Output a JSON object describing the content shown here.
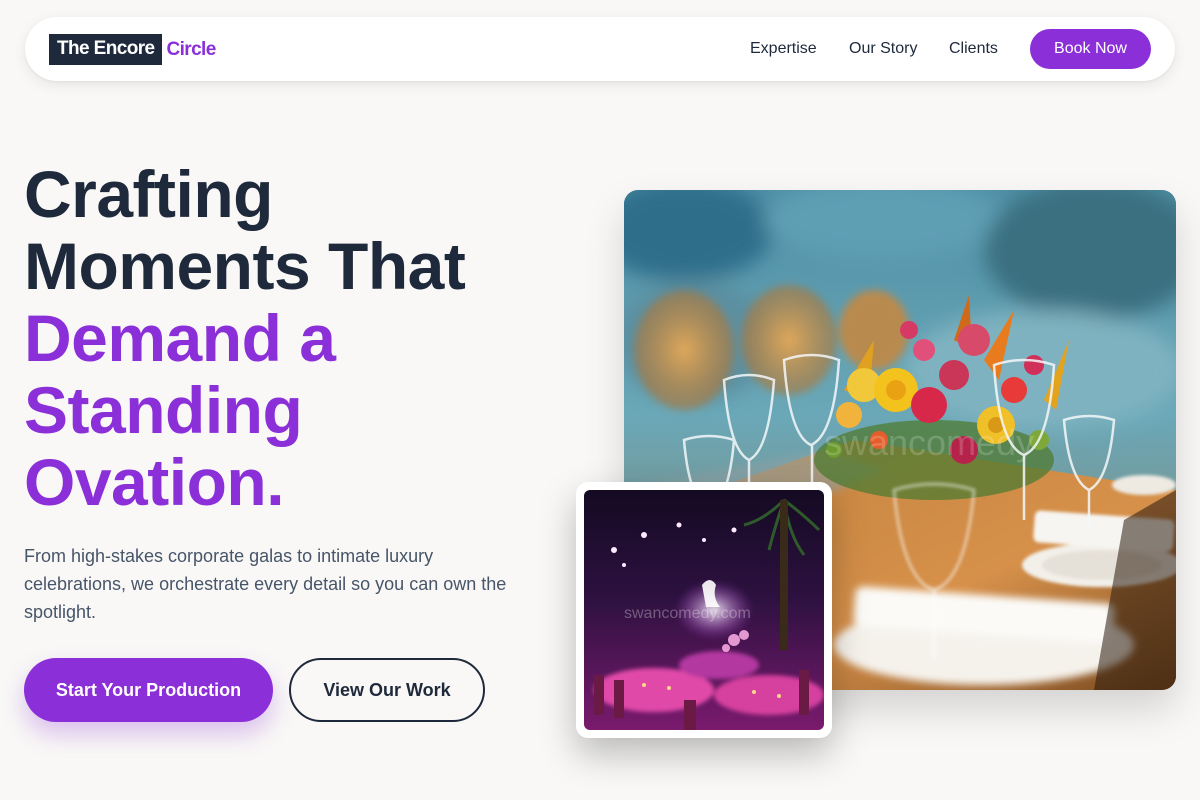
{
  "brand": {
    "name_dark": "The Encore",
    "name_accent": "Circle"
  },
  "nav": {
    "links": [
      "Expertise",
      "Our Story",
      "Clients"
    ],
    "cta_label": "Book Now"
  },
  "hero": {
    "title_lines_dark": [
      "Crafting",
      "Moments That"
    ],
    "title_lines_accent": [
      "Demand a",
      "Standing",
      "Ovation."
    ],
    "subtitle": "From high-stakes corporate galas to intimate luxury celebrations, we orchestrate every detail so you can own the spotlight.",
    "primary_button": "Start Your Production",
    "secondary_button": "View Our Work"
  },
  "images": {
    "main_watermark": "swancomedy",
    "secondary_watermark": "swancomedy.com"
  },
  "colors": {
    "accent": "#8b2fd9",
    "dark": "#1e293b",
    "background": "#f9f8f6"
  }
}
